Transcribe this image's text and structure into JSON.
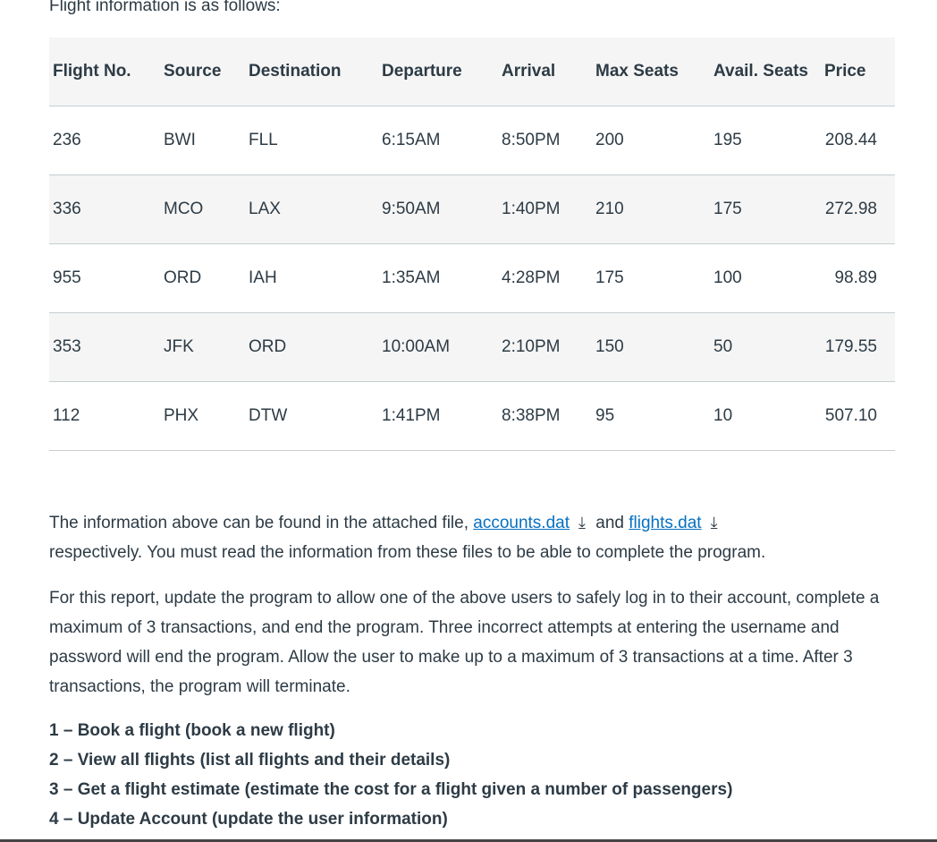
{
  "intro": "Flight information is as follows:",
  "table": {
    "headers": [
      "Flight No.",
      "Source",
      "Destination",
      "Departure",
      "Arrival",
      "Max Seats",
      "Avail. Seats",
      "Price"
    ],
    "rows": [
      [
        "236",
        "BWI",
        "FLL",
        "6:15AM",
        "8:50PM",
        "200",
        "195",
        "208.44"
      ],
      [
        "336",
        "MCO",
        "LAX",
        "9:50AM",
        "1:40PM",
        "210",
        "175",
        "272.98"
      ],
      [
        "955",
        "ORD",
        "IAH",
        "1:35AM",
        "4:28PM",
        "175",
        "100",
        "98.89"
      ],
      [
        "353",
        "JFK",
        "ORD",
        "10:00AM",
        "2:10PM",
        "150",
        "50",
        "179.55"
      ],
      [
        "112",
        "PHX",
        "DTW",
        "1:41PM",
        "8:38PM",
        "95",
        "10",
        "507.10"
      ]
    ]
  },
  "p1": {
    "a": "The information above can be found in the attached file, ",
    "link1": "accounts.dat",
    "b": " and ",
    "link2": "flights.dat",
    "c": "respectively. You must read the information from these files to be able to complete the program.",
    "icon": "download-icon"
  },
  "p2": "For this report, update the program to allow one of the above users to safely log in to their account, complete a maximum of 3 transactions, and end the program.  Three incorrect attempts at entering the username and password will end the program. Allow the user to make up to a maximum of 3 transactions at a time. After 3 transactions, the program will terminate.",
  "menu": [
    "1 – Book a flight (book a new flight)",
    "2 – View all flights (list all flights and their details)",
    "3 – Get a flight estimate (estimate the cost for a flight given a number of passengers)",
    "4 – Update Account (update the user information)"
  ]
}
